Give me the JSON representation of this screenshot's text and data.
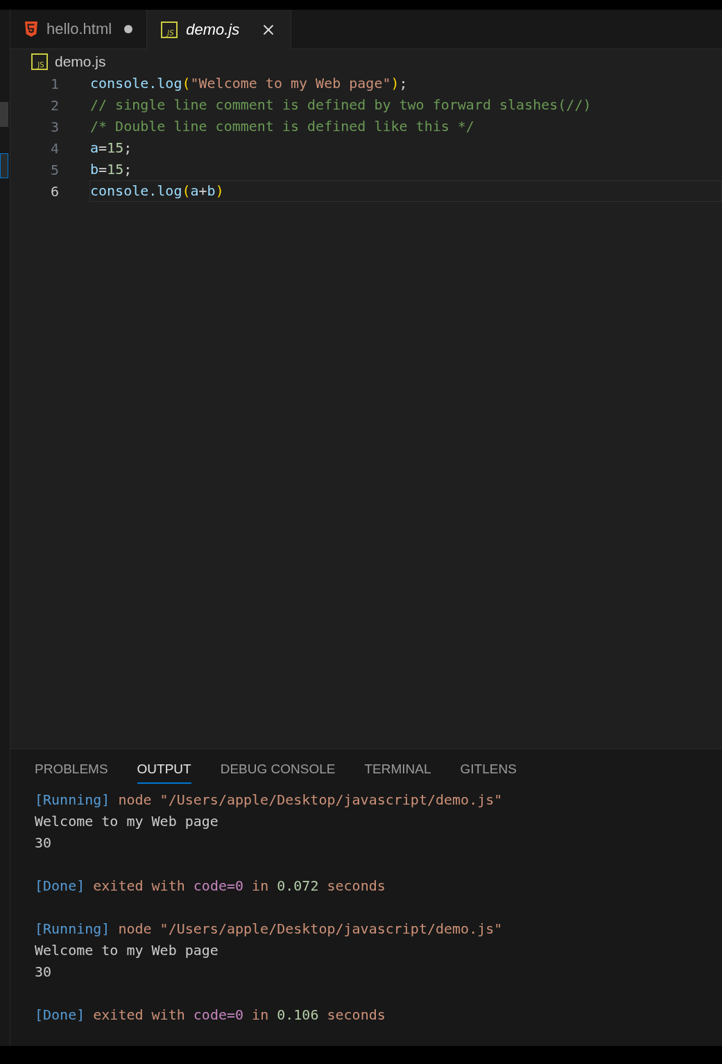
{
  "tabs": [
    {
      "label": "hello.html",
      "kind": "html",
      "selected": false,
      "modified": true
    },
    {
      "label": "demo.js",
      "kind": "js",
      "icon_text": "JS",
      "selected": true,
      "modified": false
    }
  ],
  "breadcrumb": {
    "kind": "js",
    "icon_text": "JS",
    "label": "demo.js"
  },
  "code_lines": [
    {
      "number": "1",
      "selected": false,
      "tokens": [
        {
          "kind": "fn",
          "text": "console.log"
        },
        {
          "kind": "paren",
          "text": "("
        },
        {
          "kind": "str",
          "text": "\"Welcome to my Web page\""
        },
        {
          "kind": "paren",
          "text": ")"
        },
        {
          "kind": "punc",
          "text": ";"
        }
      ]
    },
    {
      "number": "2",
      "selected": false,
      "tokens": [
        {
          "kind": "comment",
          "text": "// single line comment is defined by two forward slashes(//)"
        }
      ]
    },
    {
      "number": "3",
      "selected": false,
      "tokens": [
        {
          "kind": "comment",
          "text": "/* Double line comment is defined like this */"
        }
      ]
    },
    {
      "number": "4",
      "selected": false,
      "tokens": [
        {
          "kind": "var",
          "text": "a"
        },
        {
          "kind": "punc",
          "text": "="
        },
        {
          "kind": "num",
          "text": "15"
        },
        {
          "kind": "punc",
          "text": ";"
        }
      ]
    },
    {
      "number": "5",
      "selected": false,
      "tokens": [
        {
          "kind": "var",
          "text": "b"
        },
        {
          "kind": "punc",
          "text": "="
        },
        {
          "kind": "num",
          "text": "15"
        },
        {
          "kind": "punc",
          "text": ";"
        }
      ]
    },
    {
      "number": "6",
      "selected": true,
      "tokens": [
        {
          "kind": "fn",
          "text": "console.log"
        },
        {
          "kind": "paren",
          "text": "("
        },
        {
          "kind": "var",
          "text": "a"
        },
        {
          "kind": "punc",
          "text": "+"
        },
        {
          "kind": "var",
          "text": "b"
        },
        {
          "kind": "paren",
          "text": ")"
        }
      ]
    }
  ],
  "panel_tabs": [
    {
      "label": "PROBLEMS",
      "selected": false
    },
    {
      "label": "OUTPUT",
      "selected": true
    },
    {
      "label": "DEBUG CONSOLE",
      "selected": false
    },
    {
      "label": "TERMINAL",
      "selected": false
    },
    {
      "label": "GITLENS",
      "selected": false
    }
  ],
  "output_runs": [
    {
      "command": [
        {
          "kind": "tag",
          "text": "[Running]"
        },
        {
          "kind": "text",
          "text": " node \"/Users/apple/Desktop/javascript/demo.js\""
        }
      ],
      "output": [
        "Welcome to my Web page",
        "30"
      ],
      "done": [
        {
          "kind": "tag",
          "text": "[Done]"
        },
        {
          "kind": "text",
          "text": " exited with "
        },
        {
          "kind": "code",
          "text": "code=0"
        },
        {
          "kind": "text",
          "text": " in "
        },
        {
          "kind": "num",
          "text": "0.072"
        },
        {
          "kind": "text",
          "text": " seconds"
        }
      ]
    },
    {
      "command": [
        {
          "kind": "tag",
          "text": "[Running]"
        },
        {
          "kind": "text",
          "text": " node \"/Users/apple/Desktop/javascript/demo.js\""
        }
      ],
      "output": [
        "Welcome to my Web page",
        "30"
      ],
      "done": [
        {
          "kind": "tag",
          "text": "[Done]"
        },
        {
          "kind": "text",
          "text": " exited with "
        },
        {
          "kind": "code",
          "text": "code=0"
        },
        {
          "kind": "text",
          "text": " in "
        },
        {
          "kind": "num",
          "text": "0.106"
        },
        {
          "kind": "text",
          "text": " seconds"
        }
      ]
    }
  ]
}
